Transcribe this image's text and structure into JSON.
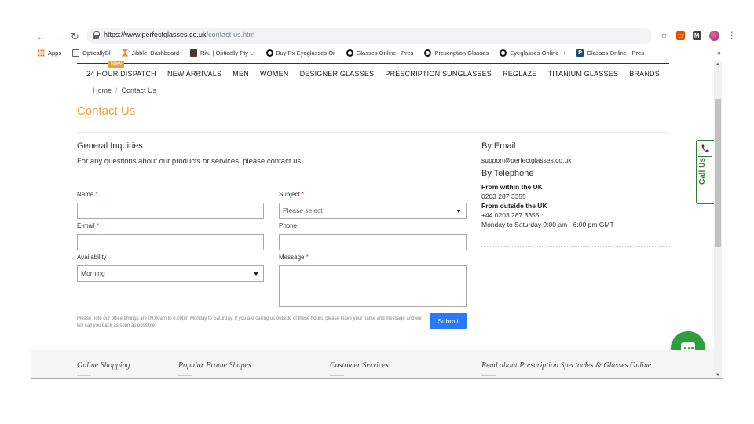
{
  "browser": {
    "url_prefix": "https://www.perfectglasses.co.uk",
    "url_path": "/contact-us.htm",
    "bookmarks": [
      {
        "label": "Apps",
        "icon": "apps-grid-icon"
      },
      {
        "label": "OpticallyBl",
        "icon": "document-icon"
      },
      {
        "label": "Jibble: Dashboard",
        "icon": "hourglass-icon"
      },
      {
        "label": "Ritu | Optically Pty Lt",
        "icon": "square-logo-icon"
      },
      {
        "label": "Buy Rx Eyeglasses Or",
        "icon": "glasses-logo-icon"
      },
      {
        "label": "Glasses Online - Pres",
        "icon": "glasses-logo-icon"
      },
      {
        "label": "Prescription Glasses",
        "icon": "glasses-logo-icon"
      },
      {
        "label": "Eyeglasses Online - I",
        "icon": "glasses-logo-icon"
      },
      {
        "label": "Glasses Online - Pres",
        "icon": "p-logo-icon"
      }
    ],
    "more": "»"
  },
  "site_nav": {
    "new_badge": "New",
    "items": [
      "24 HOUR DISPATCH",
      "NEW ARRIVALS",
      "MEN",
      "WOMEN",
      "DESIGNER GLASSES",
      "PRESCRIPTION SUNGLASSES",
      "REGLAZE",
      "TITANIUM GLASSES",
      "BRANDS"
    ]
  },
  "breadcrumb": {
    "home": "Home",
    "sep": "/",
    "current": "Contact Us"
  },
  "page_title": "Contact Us",
  "form": {
    "title": "General Inquiries",
    "subtitle": "For any questions about our products or services, please contact us:",
    "name_label": "Name",
    "subject_label": "Subject",
    "subject_placeholder": "Please select",
    "email_label": "E-mail",
    "phone_label": "Phone",
    "availability_label": "Availability",
    "availability_value": "Morning",
    "message_label": "Message",
    "required_mark": "*",
    "note": "Please note our office timings are 09:00am to 6.00pm Monday to Saturday. If you are calling us outside of these hours, please leave your name and message and we will call you back as soon as possible.",
    "submit": "Submit"
  },
  "contact": {
    "email_title": "By Email",
    "email": "support@perfectglasses.co.uk",
    "tel_title": "By Telephone",
    "uk_label": "From within the UK",
    "uk_number": "0203 287 3355",
    "intl_label": "From outside the UK",
    "intl_number": "+44 0203 287 3355",
    "hours": "Monday to Saturday 9:00 am - 6:00 pm GMT"
  },
  "call_tab": {
    "label": "Call Us"
  },
  "footer": {
    "columns": [
      "Online Shopping",
      "Popular Frame Shapes",
      "Customer Services",
      "Read about Prescription Spectacles & Glasses Online"
    ]
  },
  "colors": {
    "accent": "#f0a030",
    "submit": "#2979ff",
    "call_green": "#2e7d32",
    "chat_green": "#2e9d3c"
  }
}
